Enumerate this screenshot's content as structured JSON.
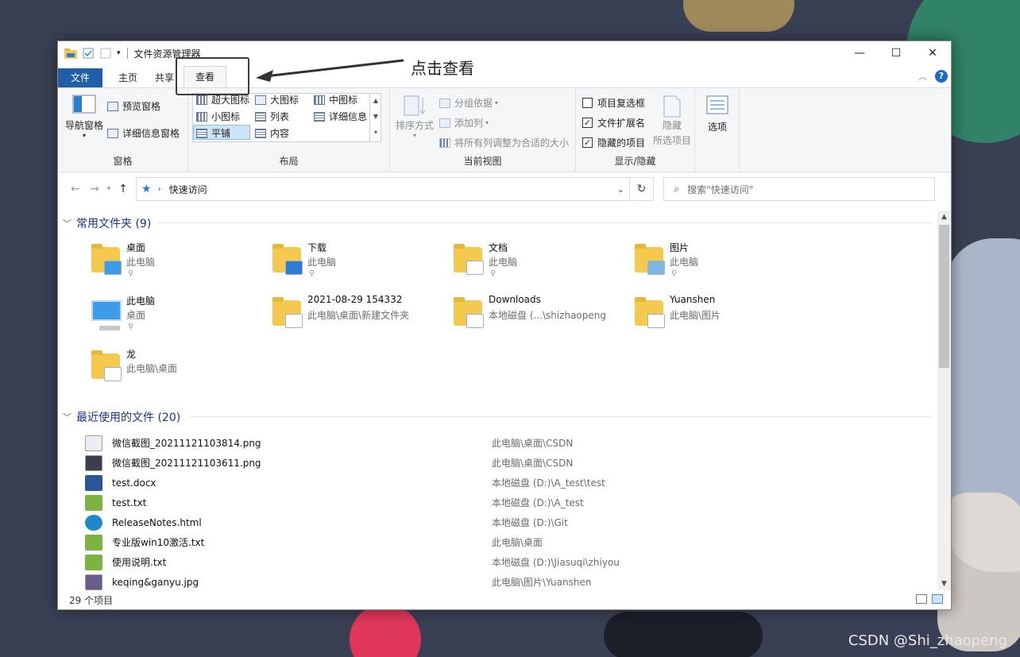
{
  "window": {
    "title": "文件资源管理器"
  },
  "annotation": {
    "text": "点击查看"
  },
  "tabs": [
    {
      "label": "文件"
    },
    {
      "label": "主页"
    },
    {
      "label": "共享"
    },
    {
      "label": "查看"
    }
  ],
  "ribbon": {
    "panes": {
      "nav_pane": "导航窗格",
      "preview_pane": "预览窗格",
      "details_pane": "详细信息窗格",
      "group_label": "窗格"
    },
    "layout": {
      "items": [
        "超大图标",
        "大图标",
        "中图标",
        "小图标",
        "列表",
        "详细信息",
        "平铺",
        "内容"
      ],
      "group_label": "布局"
    },
    "current_view": {
      "sort_by": "排序方式",
      "group_by": "分组依据",
      "add_column": "添加列",
      "fit_columns": "将所有列调整为合适的大小",
      "group_label": "当前视图"
    },
    "show_hide": {
      "item_checkboxes": "项目复选框",
      "file_extensions": "文件扩展名",
      "hidden_items": "隐藏的项目",
      "hide_selected_line1": "隐藏",
      "hide_selected_line2": "所选项目",
      "group_label": "显示/隐藏",
      "checked": {
        "item_checkboxes": false,
        "file_extensions": true,
        "hidden_items": true
      }
    },
    "options": {
      "label": "选项"
    }
  },
  "addressbar": {
    "path": "快速访问",
    "search_placeholder": "搜索\"快速访问\""
  },
  "frequent": {
    "header": "常用文件夹 (9)",
    "items": [
      {
        "name": "桌面",
        "location": "此电脑",
        "pinned": true,
        "icon": "desktop-folder-icon"
      },
      {
        "name": "下载",
        "location": "此电脑",
        "pinned": true,
        "icon": "downloads-folder-icon"
      },
      {
        "name": "文档",
        "location": "此电脑",
        "pinned": true,
        "icon": "documents-folder-icon"
      },
      {
        "name": "图片",
        "location": "此电脑",
        "pinned": true,
        "icon": "pictures-folder-icon"
      },
      {
        "name": "此电脑",
        "location": "桌面",
        "pinned": true,
        "icon": "this-pc-icon"
      },
      {
        "name": "2021-08-29 154332",
        "location": "此电脑\\桌面\\新建文件夹",
        "pinned": false,
        "icon": "folder-icon"
      },
      {
        "name": "Downloads",
        "location": "本地磁盘 (...\\shizhaopeng",
        "pinned": false,
        "icon": "folder-icon"
      },
      {
        "name": "Yuanshen",
        "location": "此电脑\\图片",
        "pinned": false,
        "icon": "folder-icon"
      },
      {
        "name": "龙",
        "location": "此电脑\\桌面",
        "pinned": false,
        "icon": "folder-icon"
      }
    ]
  },
  "recent": {
    "header": "最近使用的文件 (20)",
    "items": [
      {
        "name": "微信截图_20211121103814.png",
        "location": "此电脑\\桌面\\CSDN",
        "icon": "image-file-icon",
        "color": "#e9eef5"
      },
      {
        "name": "微信截图_20211121103611.png",
        "location": "此电脑\\桌面\\CSDN",
        "icon": "image-file-icon",
        "color": "#3a3f4c"
      },
      {
        "name": "test.docx",
        "location": "本地磁盘 (D:)\\A_test\\test",
        "icon": "word-file-icon",
        "color": "#2b5797"
      },
      {
        "name": "test.txt",
        "location": "本地磁盘 (D:)\\A_test",
        "icon": "text-file-icon",
        "color": "#7cb342"
      },
      {
        "name": "ReleaseNotes.html",
        "location": "本地磁盘 (D:)\\Git",
        "icon": "edge-html-icon",
        "color": "#1e88c9"
      },
      {
        "name": "专业版win10激活.txt",
        "location": "此电脑\\桌面",
        "icon": "text-file-icon",
        "color": "#7cb342"
      },
      {
        "name": "使用说明.txt",
        "location": "本地磁盘 (D:)\\Jiasuqi\\zhiyou",
        "icon": "text-file-icon",
        "color": "#7cb342"
      },
      {
        "name": "keqing&ganyu.jpg",
        "location": "此电脑\\图片\\Yuanshen",
        "icon": "image-file-icon",
        "color": "#6b5b8a"
      }
    ]
  },
  "status": {
    "count": "29 个项目"
  },
  "watermark": "CSDN @Shi_zhaopeng"
}
